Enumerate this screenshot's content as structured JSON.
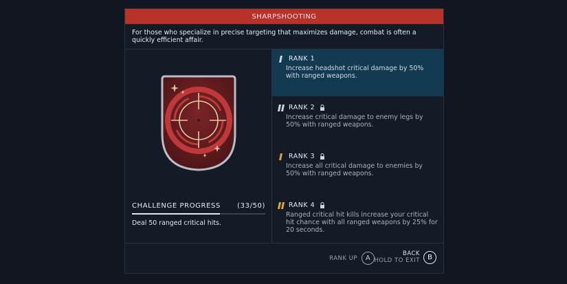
{
  "title": "SHARPSHOOTING",
  "description": "For those who specialize in precise targeting that maximizes damage, combat is often a quickly efficient affair.",
  "challenge": {
    "label": "CHALLENGE PROGRESS",
    "count": "(33/50)",
    "progress_fraction": 0.66,
    "text": "Deal 50 ranged critical hits."
  },
  "ranks": [
    {
      "label": "RANK 1",
      "locked": false,
      "active": true,
      "description": "Increase headshot critical damage by 50% with ranged weapons.",
      "icon_color": "#cfd6de"
    },
    {
      "label": "RANK 2",
      "locked": true,
      "active": false,
      "description": "Increase critical damage to enemy legs by 50% with ranged weapons.",
      "icon_color": "#cfd6de"
    },
    {
      "label": "RANK 3",
      "locked": true,
      "active": false,
      "description": "Increase all critical damage to enemies by 50% with ranged weapons.",
      "icon_color": "#e0a43a"
    },
    {
      "label": "RANK 4",
      "locked": true,
      "active": false,
      "description": "Ranged critical hit kills increase your critical hit chance with all ranged weapons by 25% for 20 seconds.",
      "icon_color": "#e0a43a"
    }
  ],
  "footer": {
    "rank_up_label": "RANK UP",
    "rank_up_key": "A",
    "back_label": "BACK",
    "hold_exit_label": "HOLD TO EXIT",
    "back_key": "B"
  },
  "colors": {
    "title_bar": "#b8322a",
    "active_rank": "#133a51",
    "badge_bg": "#6b1d1f",
    "badge_ring": "#c0393a",
    "badge_accent": "#e6c7a3"
  },
  "icons": [
    "rank-bar-icon",
    "lock-icon",
    "crosshair-icon",
    "sparkle-icon"
  ]
}
